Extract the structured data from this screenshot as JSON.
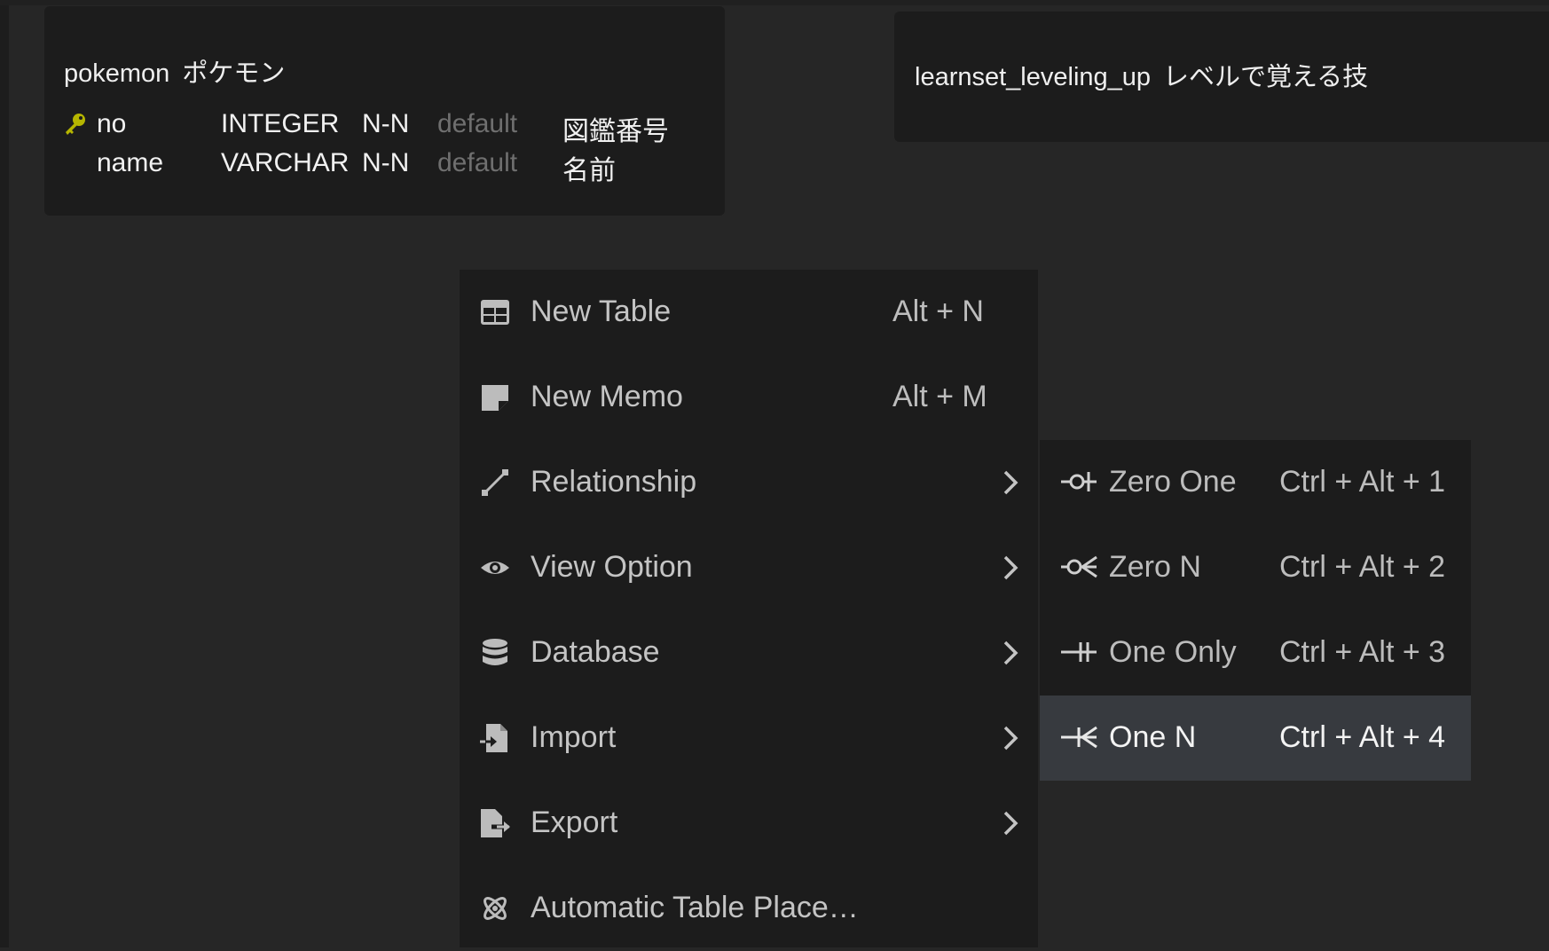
{
  "tables": [
    {
      "name": "pokemon",
      "comment": "ポケモン",
      "columns": [
        {
          "name": "no",
          "type": "INTEGER",
          "nullable": "N-N",
          "default": "default",
          "comment": "図鑑番号",
          "primary_key": true
        },
        {
          "name": "name",
          "type": "VARCHAR",
          "nullable": "N-N",
          "default": "default",
          "comment": "名前",
          "primary_key": false
        }
      ]
    },
    {
      "name": "learnset_leveling_up",
      "comment": "レベルで覚える技",
      "columns": []
    }
  ],
  "context_menu": {
    "items": [
      {
        "label": "New Table",
        "shortcut": "Alt + N",
        "icon": "table-icon",
        "has_submenu": false
      },
      {
        "label": "New Memo",
        "shortcut": "Alt + M",
        "icon": "memo-icon",
        "has_submenu": false
      },
      {
        "label": "Relationship",
        "shortcut": "",
        "icon": "relationship-icon",
        "has_submenu": true
      },
      {
        "label": "View Option",
        "shortcut": "",
        "icon": "eye-icon",
        "has_submenu": true
      },
      {
        "label": "Database",
        "shortcut": "",
        "icon": "database-icon",
        "has_submenu": true
      },
      {
        "label": "Import",
        "shortcut": "",
        "icon": "import-icon",
        "has_submenu": true
      },
      {
        "label": "Export",
        "shortcut": "",
        "icon": "export-icon",
        "has_submenu": true
      },
      {
        "label": "Automatic Table Place…",
        "shortcut": "",
        "icon": "atom-icon",
        "has_submenu": false
      }
    ]
  },
  "relationship_submenu": {
    "items": [
      {
        "label": "Zero One",
        "shortcut": "Ctrl + Alt + 1",
        "icon": "zero-one-icon"
      },
      {
        "label": "Zero N",
        "shortcut": "Ctrl + Alt + 2",
        "icon": "zero-n-icon"
      },
      {
        "label": "One Only",
        "shortcut": "Ctrl + Alt + 3",
        "icon": "one-only-icon"
      },
      {
        "label": "One N",
        "shortcut": "Ctrl + Alt + 4",
        "icon": "one-n-icon",
        "active": true
      }
    ]
  },
  "colors": {
    "canvas": "#262626",
    "panel": "#1c1c1c",
    "active_item": "#373a3f",
    "primary_key": "#b5b500",
    "muted_text": "#6f6f6f"
  }
}
